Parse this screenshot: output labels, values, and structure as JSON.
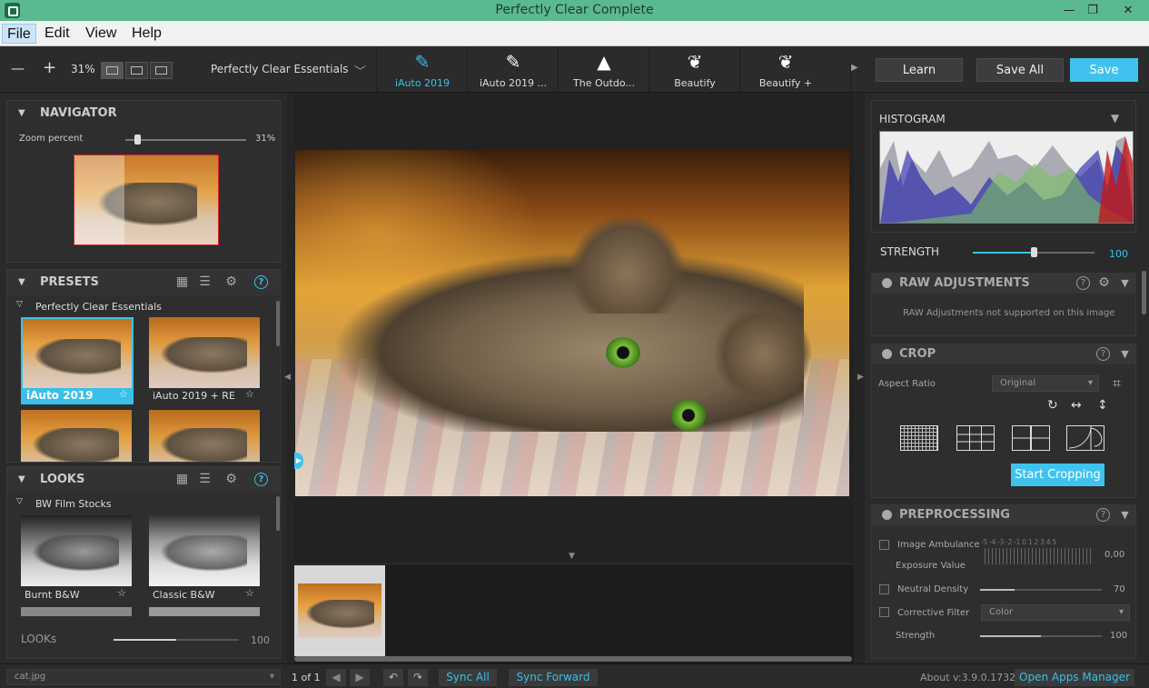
{
  "window": {
    "title": "Perfectly Clear Complete",
    "minimize": "—",
    "maximize": "❐",
    "close": "✕"
  },
  "menu": [
    "File",
    "Edit",
    "View",
    "Help"
  ],
  "toolbar": {
    "zoom_out": "—",
    "zoom_in": "+",
    "zoom": "31%",
    "preset_group": "Perfectly Clear Essentials",
    "tabs": [
      {
        "label": "iAuto 2019",
        "icon": "brush-icon"
      },
      {
        "label": "iAuto 2019 ...",
        "icon": "brush-icon"
      },
      {
        "label": "The Outdo...",
        "icon": "landscape-icon"
      },
      {
        "label": "Beautify",
        "icon": "face-icon"
      },
      {
        "label": "Beautify +",
        "icon": "face-plus-icon"
      }
    ],
    "more": "▶",
    "learn": "Learn",
    "save_all": "Save All",
    "save": "Save"
  },
  "navigator": {
    "title": "NAVIGATOR",
    "zoom_label": "Zoom percent",
    "zoom_value": "31%",
    "zoom_fraction": 0.1
  },
  "presets": {
    "title": "PRESETS",
    "group": "Perfectly Clear Essentials",
    "items": [
      {
        "label": "iAuto 2019",
        "selected": true
      },
      {
        "label": "iAuto 2019 + RE",
        "selected": false
      },
      {
        "label": "",
        "selected": false
      },
      {
        "label": "",
        "selected": false
      }
    ]
  },
  "looks": {
    "title": "LOOKS",
    "group": "BW Film Stocks",
    "items": [
      {
        "label": "Burnt B&W"
      },
      {
        "label": "Classic B&W"
      }
    ],
    "strength_label": "LOOKs",
    "strength_value": "100",
    "strength_fraction": 0.5
  },
  "right": {
    "histogram_title": "HISTOGRAM",
    "strength_label": "STRENGTH",
    "strength_value": "100",
    "strength_fraction": 0.5,
    "raw_title": "RAW ADJUSTMENTS",
    "raw_message": "RAW Adjustments not supported on this image",
    "crop_title": "CROP",
    "aspect_label": "Aspect Ratio",
    "aspect_value": "Original",
    "start_cropping": "Start Cropping",
    "pre_title": "PREPROCESSING",
    "ambulance_label": "Image Ambulance",
    "ambulance_scale": "-5 -4 -3 -2 -1 0 1 2 3 4 5",
    "exposure_label": "Exposure Value",
    "exposure_value": "0,00",
    "nd_label": "Neutral Density",
    "nd_value": "70",
    "nd_fraction": 0.28,
    "cf_label": "Corrective Filter",
    "cf_value": "Color",
    "cf_strength_label": "Strength",
    "cf_strength_value": "100",
    "cf_strength_fraction": 0.5
  },
  "status": {
    "file": "cat.jpg",
    "count": "1 of 1",
    "sync_all": "Sync All",
    "sync_forward": "Sync Forward",
    "about": "About v:3.9.0.1732",
    "apps_manager": "Open Apps Manager"
  },
  "colors": {
    "accent": "#3fc3ee",
    "title_bar": "#5bb98f",
    "panel": "#2e2e2e"
  }
}
